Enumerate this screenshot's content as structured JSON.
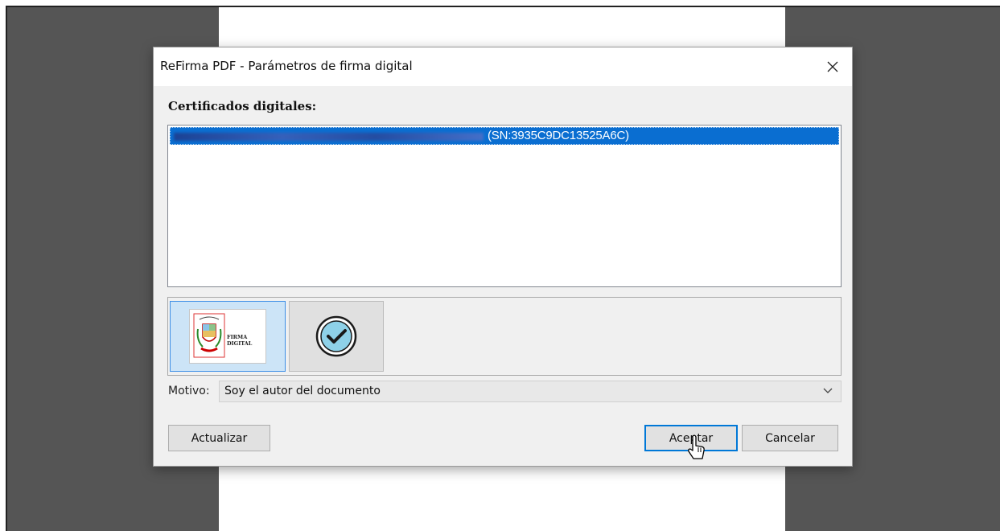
{
  "dialog": {
    "title": "ReFirma PDF - Parámetros de firma digital",
    "close_icon": "close-icon"
  },
  "certificates": {
    "label": "Certificados digitales:",
    "items": [
      {
        "serial": "(SN:3935C9DC13525A6C)",
        "name_redacted": true,
        "selected": true
      }
    ]
  },
  "signature_images": [
    {
      "name": "firma-digital-seal",
      "label": "FIRMA DIGITAL",
      "selected": true
    },
    {
      "name": "check-circle-icon",
      "selected": false
    }
  ],
  "motivo": {
    "label": "Motivo:",
    "value": "Soy el autor del documento"
  },
  "buttons": {
    "actualizar": "Actualizar",
    "aceptar": "Aceptar",
    "cancelar": "Cancelar"
  },
  "colors": {
    "selection": "#0a6ed1",
    "accent_border": "#0078d7",
    "background_dark": "#555555",
    "dialog_bg": "#f0f0f0"
  }
}
